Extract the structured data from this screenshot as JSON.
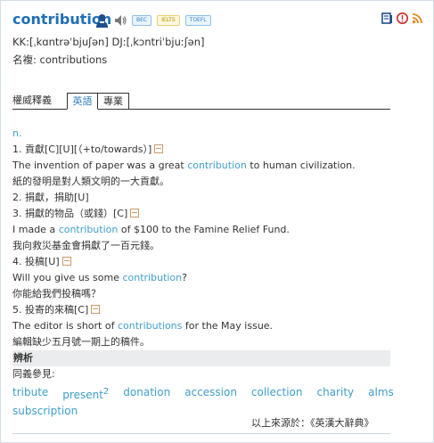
{
  "entry": {
    "headword": "contribution",
    "badges": [
      "BEC",
      "IELTS",
      "TOEFL"
    ],
    "pronunciation": "KK:[ˌkɑntrəˈbjuʃən] DJ:[ˌkɔntriˈbjuːʃən]",
    "plural": "名複: contributions"
  },
  "tabs": {
    "authority": "權威釋義",
    "english": "英語",
    "professional": "專業"
  },
  "senses": {
    "pos": "n.",
    "s1_def": "1. 貢獻[C][U][（+to/towards）]",
    "s1_ex_pre": "The invention of paper was a great ",
    "s1_ex_kw": "contribution",
    "s1_ex_post": " to human civilization.",
    "s1_zh": "紙的發明是對人類文明的一大貢獻。",
    "s2_def": "2. 捐獻，捐助[U]",
    "s3_def": "3. 捐獻的物品（或錢）[C]",
    "s3_ex_pre": "I made a ",
    "s3_ex_kw": "contribution",
    "s3_ex_post": " of $100 to the Famine Relief Fund.",
    "s3_zh": "我向救災基金會捐獻了一百元錢。",
    "s4_def": "4. 投稿[U]",
    "s4_ex_pre": "Will you give us some ",
    "s4_ex_kw": "contribution",
    "s4_ex_post": "?",
    "s4_zh": "你能給我們投稿嗎？",
    "s5_def": "5. 投寄的來稿[C]",
    "s5_ex_pre": "The editor is short of ",
    "s5_ex_kw": "contributions",
    "s5_ex_post": " for the May issue.",
    "s5_zh": "編輯缺少五月號一期上的稿件。"
  },
  "notes": {
    "header": "辨析",
    "see_also": "同義參見:",
    "synonyms": [
      "tribute",
      "present",
      "donation",
      "accession",
      "collection",
      "charity",
      "alms"
    ],
    "present_sup": "2",
    "synonym_last": "subscription"
  },
  "source": "以上來源於：《英漢大辭典》"
}
